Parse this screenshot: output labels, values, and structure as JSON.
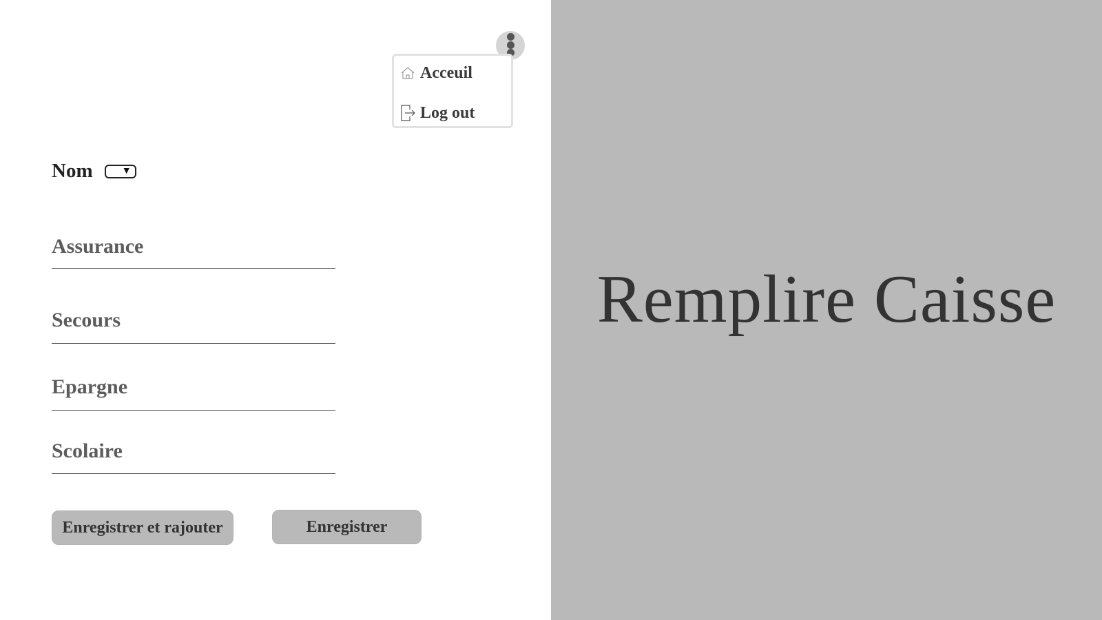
{
  "header": {
    "title": "Remplire Caisse"
  },
  "menu": {
    "toggle_icon": "kebab-vertical-icon",
    "items": [
      {
        "label": "Acceuil",
        "icon": "home-icon"
      },
      {
        "label": "Log out",
        "icon": "logout-icon"
      }
    ]
  },
  "form": {
    "nom_label": "Nom",
    "fields": [
      {
        "placeholder": "Assurance",
        "value": ""
      },
      {
        "placeholder": "Secours",
        "value": ""
      },
      {
        "placeholder": "Epargne",
        "value": ""
      },
      {
        "placeholder": "Scolaire",
        "value": ""
      }
    ],
    "buttons": {
      "save_and_add": "Enregistrer et rajouter",
      "save": "Enregistrer"
    }
  },
  "colors": {
    "right_panel_bg": "#b9b9b9",
    "button_bg": "#b9b9b9",
    "title_color": "#333333"
  }
}
